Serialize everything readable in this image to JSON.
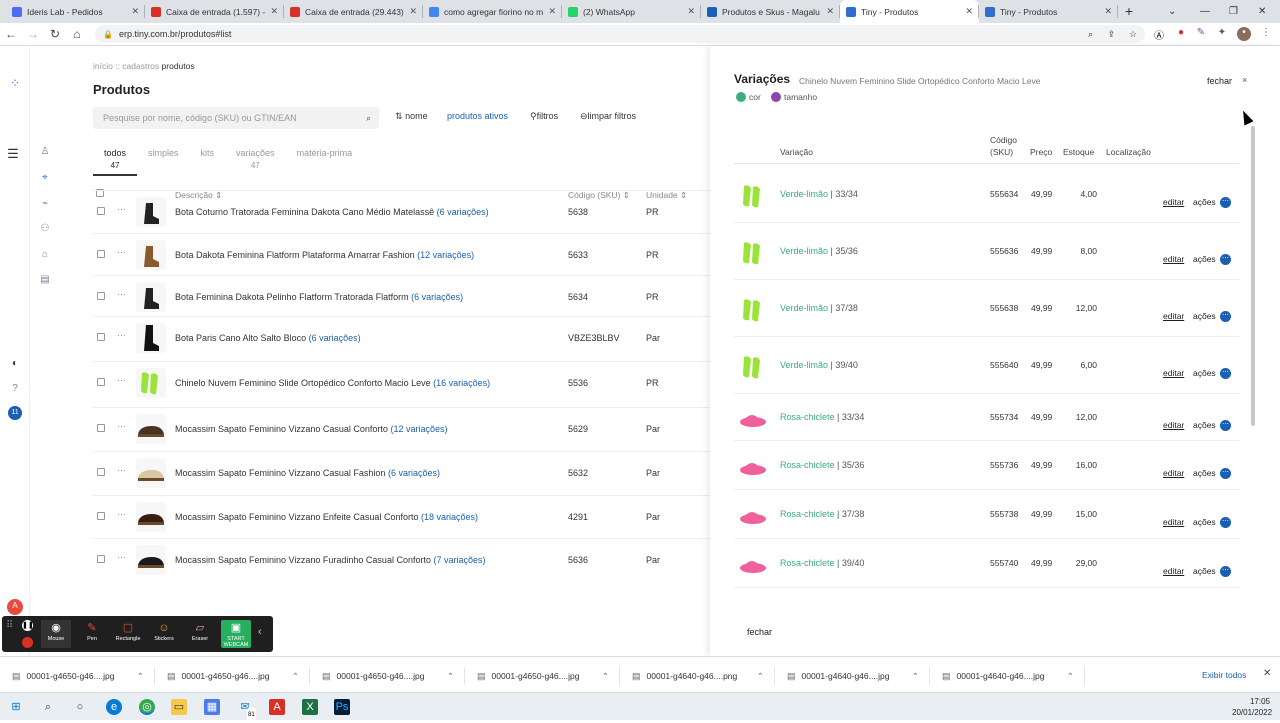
{
  "browser": {
    "tabs": [
      {
        "label": "Ideris Lab - Pedidos",
        "icon_color": "#4a6cf7"
      },
      {
        "label": "Caixa de entrada (1.597) -",
        "icon_color": "#d93025"
      },
      {
        "label": "Caixa de entrada (29.443)",
        "icon_color": "#d93025"
      },
      {
        "label": "como agregar fiorino no m",
        "icon_color": "#4285f4"
      },
      {
        "label": "(2) WhatsApp",
        "icon_color": "#25d366"
      },
      {
        "label": "Produtos e Skus - Magalu",
        "icon_color": "#1a5fb4"
      },
      {
        "label": "Tiny - Produtos",
        "icon_color": "#2f6ecf",
        "active": true
      },
      {
        "label": "Tiny - Produtos",
        "icon_color": "#2f6ecf"
      }
    ],
    "new_tab": "+",
    "url": "erp.tiny.com.br/produtos#list"
  },
  "page": {
    "breadcrumb": [
      "início",
      "cadastros",
      "produtos"
    ],
    "title": "Produtos",
    "search_placeholder": "Pesquise por nome, código (SKU) ou GTIN/EAN",
    "filters": {
      "sort": "nome",
      "active": "produtos ativos",
      "filters": "filtros",
      "clear": "limpar filtros"
    },
    "tabs": [
      {
        "label": "todos",
        "count": "47",
        "active": true
      },
      {
        "label": "simples",
        "count": ""
      },
      {
        "label": "kits",
        "count": ""
      },
      {
        "label": "variações",
        "count": "47"
      },
      {
        "label": "matéria-prima",
        "count": ""
      }
    ],
    "columns": {
      "desc": "Descrição",
      "sku": "Código (SKU)",
      "unit": "Unidade"
    },
    "products": [
      {
        "name": "Bota Coturno Tratorada Feminina Dakota Cano Médio Matelassê",
        "variations": "(6 variações)",
        "sku": "5638",
        "unit": "PR",
        "thumb": "boot-black"
      },
      {
        "name": "Bota Dakota Feminina Flatform Plataforma Amarrar Fashion",
        "variations": "(12 variações)",
        "sku": "5633",
        "unit": "PR",
        "thumb": "boot-brown"
      },
      {
        "name": "Bota Feminina Dakota Pelinho Flatform Tratorada Flatform",
        "variations": "(6 variações)",
        "sku": "5634",
        "unit": "PR",
        "thumb": "boot-black-low"
      },
      {
        "name": "Bota Paris Cano Alto Salto Bloco",
        "variations": "(6 variações)",
        "sku": "VBZE3BLBV",
        "unit": "Par",
        "thumb": "boot-tall"
      },
      {
        "name": "Chinelo Nuvem Feminino Slide Ortopédico Conforto Macio Leve",
        "variations": "(16 variações)",
        "sku": "5536",
        "unit": "PR",
        "thumb": "slide-lime"
      },
      {
        "name": "Mocassim Sapato Feminino Vizzano Casual Conforto",
        "variations": "(12 variações)",
        "sku": "5629",
        "unit": "Par",
        "thumb": "loafer-brown"
      },
      {
        "name": "Mocassim Sapato Feminino Vizzano Casual Fashion",
        "variations": "(6 variações)",
        "sku": "5632",
        "unit": "Par",
        "thumb": "loafer-beige"
      },
      {
        "name": "Mocassim Sapato Feminino Vizzano Enfeite Casual Conforto",
        "variations": "(18 variações)",
        "sku": "4291",
        "unit": "Par",
        "thumb": "loafer-dark"
      },
      {
        "name": "Mocassim Sapato Feminino Vizzano Furadinho Casual Conforto",
        "variations": "(7 variações)",
        "sku": "5636",
        "unit": "Par",
        "thumb": "loafer-black"
      }
    ]
  },
  "panel": {
    "title": "Variações",
    "subtitle": "Chinelo Nuvem Feminino Slide Ortopédico Conforto Macio Leve",
    "close_label": "fechar",
    "close_icon": "×",
    "tags": [
      {
        "label": "cor",
        "color": "#3cae7c"
      },
      {
        "label": "tamanho",
        "color": "#8e44ad"
      }
    ],
    "headers": {
      "variation": "Variação",
      "code_1": "Código",
      "code_2": "(SKU)",
      "price": "Preço",
      "stock": "Estoque",
      "location": "Localização"
    },
    "variations": [
      {
        "color": "Verde-limão",
        "size": "33/34",
        "sku": "555634",
        "price": "49,99",
        "stock": "4,00",
        "thumb": "lime"
      },
      {
        "color": "Verde-limão",
        "size": "35/36",
        "sku": "555636",
        "price": "49,99",
        "stock": "8,00",
        "thumb": "lime"
      },
      {
        "color": "Verde-limão",
        "size": "37/38",
        "sku": "555638",
        "price": "49,99",
        "stock": "12,00",
        "thumb": "lime"
      },
      {
        "color": "Verde-limão",
        "size": "39/40",
        "sku": "555640",
        "price": "49,99",
        "stock": "6,00",
        "thumb": "lime"
      },
      {
        "color": "Rosa-chiclete",
        "size": "33/34",
        "sku": "555734",
        "price": "49,99",
        "stock": "12,00",
        "thumb": "pink"
      },
      {
        "color": "Rosa-chiclete",
        "size": "35/36",
        "sku": "555736",
        "price": "49,99",
        "stock": "16,00",
        "thumb": "pink"
      },
      {
        "color": "Rosa-chiclete",
        "size": "37/38",
        "sku": "555738",
        "price": "49,99",
        "stock": "15,00",
        "thumb": "pink"
      },
      {
        "color": "Rosa-chiclete",
        "size": "39/40",
        "sku": "555740",
        "price": "49,99",
        "stock": "29,00",
        "thumb": "pink"
      }
    ],
    "edit_label": "editar",
    "actions_label": "ações",
    "footer_close": "fechar"
  },
  "recorder": {
    "tools": [
      "Mouse",
      "Pen",
      "Rectangle",
      "Stickers",
      "Eraser",
      "START WEBCAM"
    ]
  },
  "downloads": {
    "items": [
      "00001-g4650-g46....jpg",
      "00001-g4650-g46....jpg",
      "00001-g4650-g46....jpg",
      "00001-g4650-g46....jpg",
      "00001-g4640-g46....png",
      "00001-g4640-g46....jpg",
      "00001-g4640-g46....jpg"
    ],
    "show_all": "Exibir todos"
  },
  "sidebar_badge": "11",
  "avatar_letter": "A",
  "taskbar": {
    "time": "17:05",
    "date": "20/01/2022",
    "mail_badge": "81"
  }
}
